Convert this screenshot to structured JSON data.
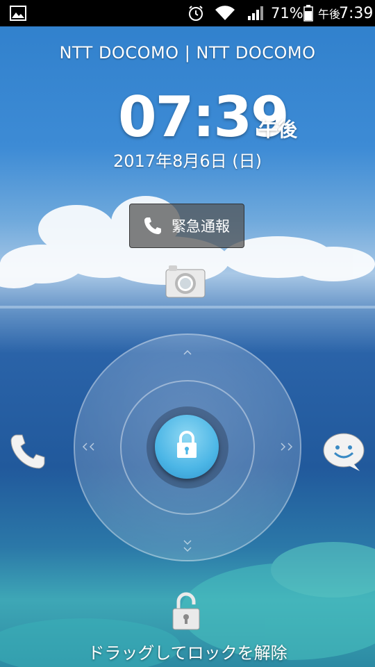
{
  "status_bar": {
    "left_icons": [
      "gallery-icon"
    ],
    "right_icons": [
      "alarm-icon",
      "wifi-icon",
      "signal-icon",
      "battery-icon"
    ],
    "battery_percent": "71%",
    "ampm": "午後",
    "time": "7:39"
  },
  "lockscreen": {
    "carrier": "NTT DOCOMO | NTT DOCOMO",
    "clock_time": "07:39",
    "clock_ampm": "午後",
    "date": "2017年8月6日 (日)",
    "emergency_label": "緊急通報",
    "unlock_hint": "ドラッグしてロックを解除"
  },
  "shortcuts": {
    "top": "camera-icon",
    "left": "phone-icon",
    "right": "messaging-icon"
  },
  "colors": {
    "lock_button": "#4cb6e6",
    "status_bar_bg": "#000000"
  }
}
